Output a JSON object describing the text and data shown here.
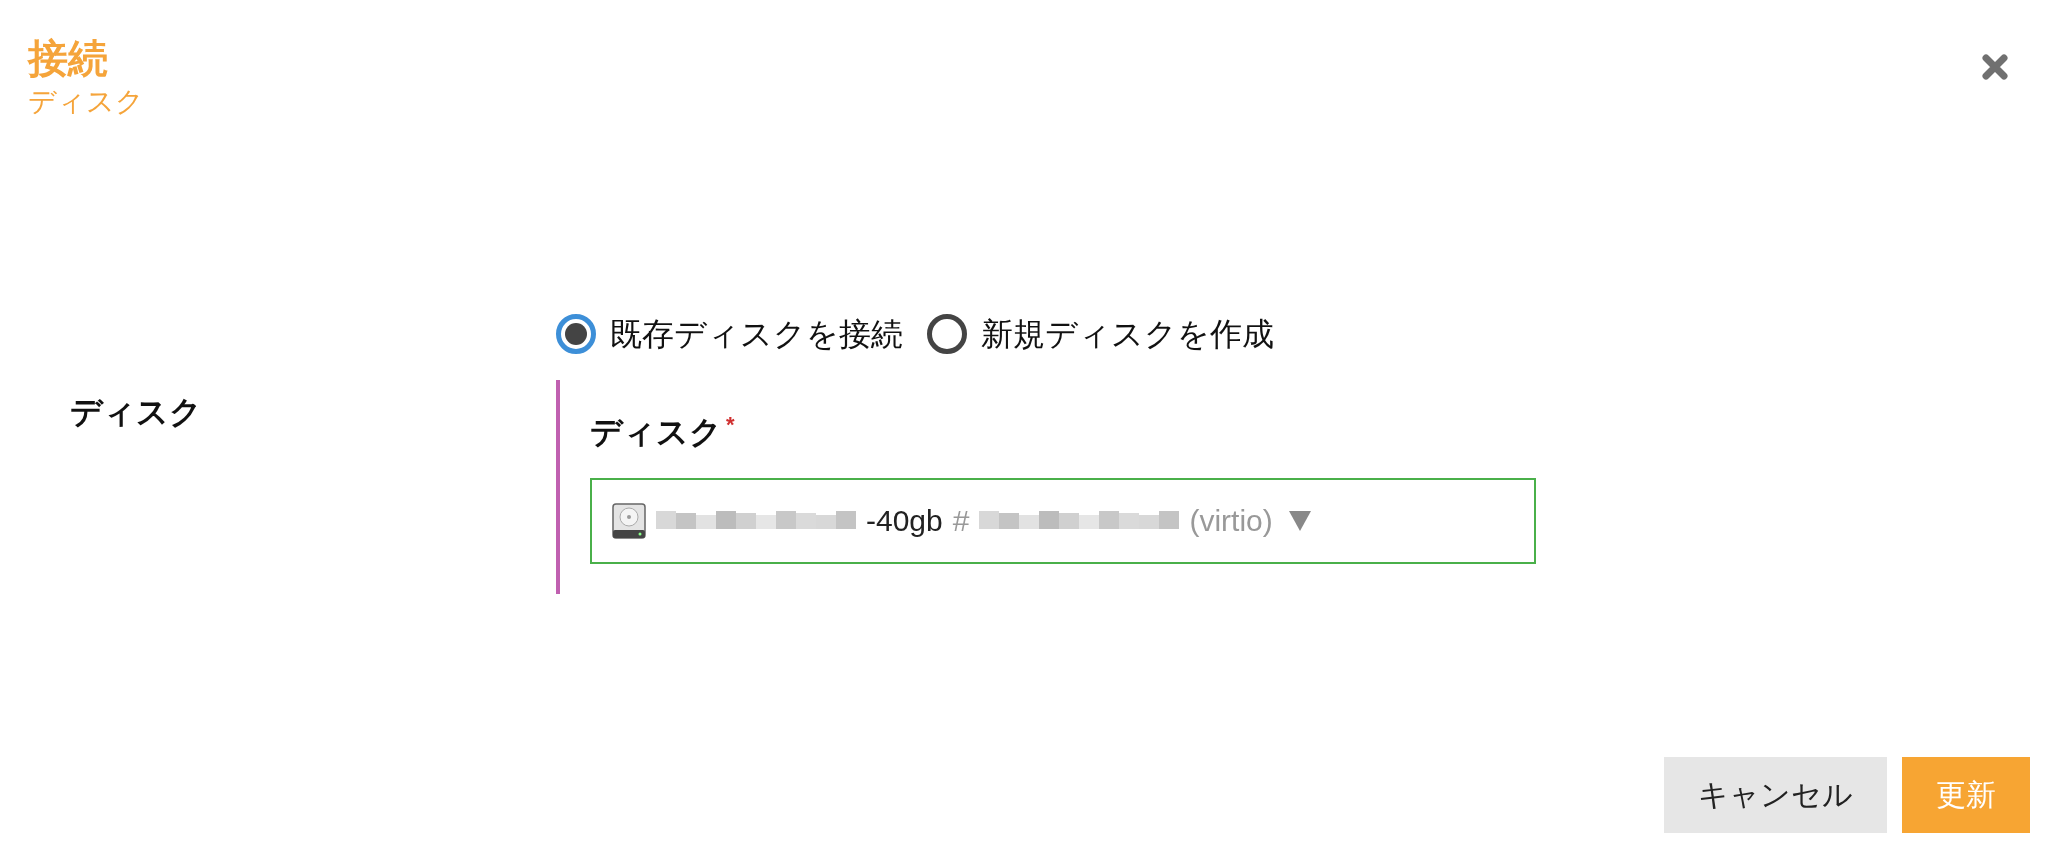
{
  "dialog": {
    "title": "接続",
    "subtitle": "ディスク"
  },
  "source_options": [
    {
      "label": "既存ディスクを接続",
      "selected": true
    },
    {
      "label": "新規ディスクを作成",
      "selected": false
    }
  ],
  "form": {
    "label": "ディスク",
    "field": {
      "label": "ディスク",
      "required_mark": "*",
      "valid": true,
      "value_parts": [
        {
          "kind": "redacted"
        },
        {
          "kind": "text",
          "text": "-40gb"
        },
        {
          "kind": "hint",
          "text": "#"
        },
        {
          "kind": "redacted"
        },
        {
          "kind": "hint",
          "text": "(virtio)"
        }
      ]
    }
  },
  "buttons": [
    {
      "label": "キャンセル",
      "kind": "secondary"
    },
    {
      "label": "更新",
      "kind": "primary"
    }
  ]
}
